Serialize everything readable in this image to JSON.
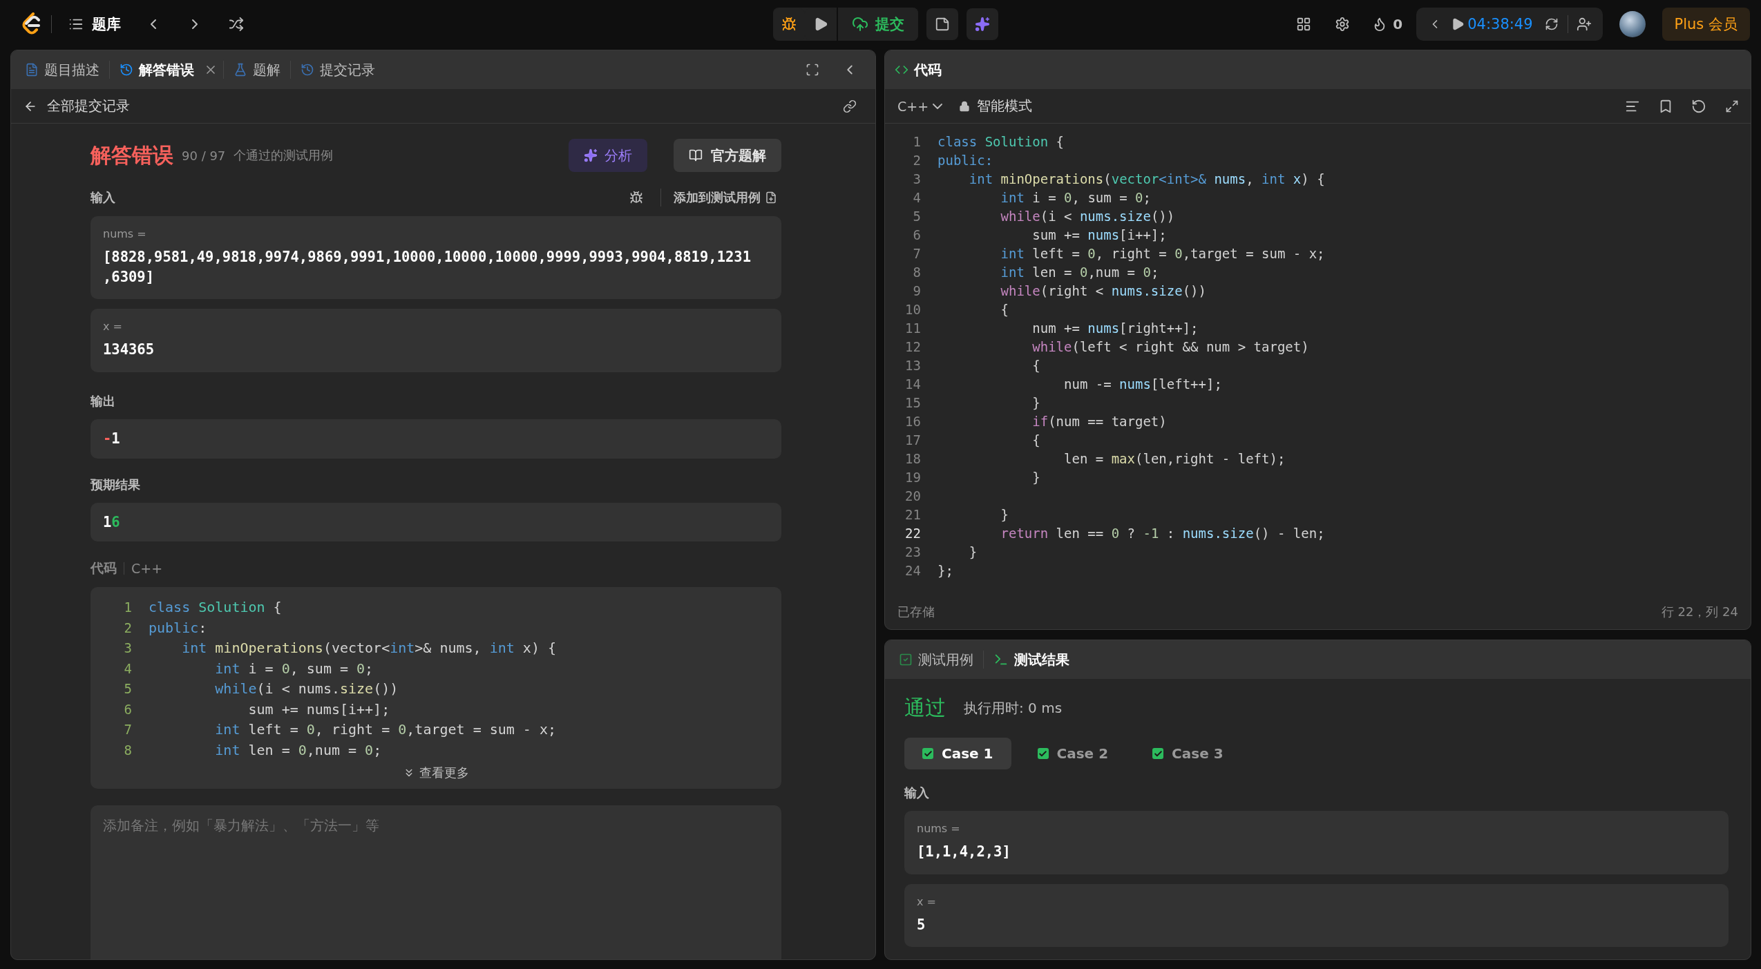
{
  "top_bar": {
    "nav_label": "题库",
    "submit_label": "提交",
    "streak": "0",
    "timer": "04:38:49",
    "plus_label": "Plus 会员"
  },
  "left_panel": {
    "tabs": [
      {
        "label": "题目描述",
        "selected": false,
        "closable": false
      },
      {
        "label": "解答错误",
        "selected": true,
        "closable": true
      },
      {
        "label": "题解",
        "selected": false,
        "closable": false
      },
      {
        "label": "提交记录",
        "selected": false,
        "closable": false
      }
    ],
    "back_link": "全部提交记录",
    "status": "解答错误",
    "passed_count": "90 / 97",
    "passed_label": "个通过的测试用例",
    "analyze_button": "分析",
    "official_button": "官方题解",
    "input_label": "输入",
    "add_testcase": "添加到测试用例",
    "inputs": [
      {
        "name": "nums =",
        "value": "[8828,9581,49,9818,9974,9869,9991,10000,10000,10000,9999,9993,9904,8819,1231,6309]"
      },
      {
        "name": "x =",
        "value": "134365"
      }
    ],
    "output_label": "输出",
    "output": [
      {
        "kind": "removed",
        "text": "-"
      },
      {
        "kind": "same",
        "text": "1"
      }
    ],
    "expected_label": "预期结果",
    "expected": [
      {
        "kind": "same",
        "text": "1"
      },
      {
        "kind": "added",
        "text": "6"
      }
    ],
    "code_label": "代码",
    "code_language": "C++",
    "code_lines": [
      {
        "number": "1",
        "tokens": [
          {
            "kind": "kw",
            "text": "class "
          },
          {
            "kind": "cls",
            "text": "Solution"
          },
          {
            "kind": "plain",
            "text": " {"
          }
        ]
      },
      {
        "number": "2",
        "tokens": [
          {
            "kind": "kw",
            "text": "public"
          },
          {
            "kind": "plain",
            "text": ":"
          }
        ]
      },
      {
        "number": "3",
        "tokens": [
          {
            "kind": "kw",
            "text": "    int "
          },
          {
            "kind": "fn",
            "text": "minOperations"
          },
          {
            "kind": "plain",
            "text": "(vector<"
          },
          {
            "kind": "kw",
            "text": "int"
          },
          {
            "kind": "plain",
            "text": ">& nums, "
          },
          {
            "kind": "kw",
            "text": "int"
          },
          {
            "kind": "plain",
            "text": " x) {"
          }
        ]
      },
      {
        "number": "4",
        "tokens": [
          {
            "kind": "kw",
            "text": "        int"
          },
          {
            "kind": "plain",
            "text": " i = "
          },
          {
            "kind": "num",
            "text": "0"
          },
          {
            "kind": "plain",
            "text": ", sum = "
          },
          {
            "kind": "num",
            "text": "0"
          },
          {
            "kind": "plain",
            "text": ";"
          }
        ]
      },
      {
        "number": "5",
        "tokens": [
          {
            "kind": "kw",
            "text": "        while"
          },
          {
            "kind": "plain",
            "text": "(i < nums."
          },
          {
            "kind": "fn",
            "text": "size"
          },
          {
            "kind": "plain",
            "text": "())"
          }
        ]
      },
      {
        "number": "6",
        "tokens": [
          {
            "kind": "plain",
            "text": "            sum += nums[i++];"
          }
        ]
      },
      {
        "number": "7",
        "tokens": [
          {
            "kind": "kw",
            "text": "        int"
          },
          {
            "kind": "plain",
            "text": " left = "
          },
          {
            "kind": "num",
            "text": "0"
          },
          {
            "kind": "plain",
            "text": ", right = "
          },
          {
            "kind": "num",
            "text": "0"
          },
          {
            "kind": "plain",
            "text": ",target = sum - x;"
          }
        ]
      },
      {
        "number": "8",
        "tokens": [
          {
            "kind": "kw",
            "text": "        int"
          },
          {
            "kind": "plain",
            "text": " len = "
          },
          {
            "kind": "num",
            "text": "0"
          },
          {
            "kind": "plain",
            "text": ",num = "
          },
          {
            "kind": "num",
            "text": "0"
          },
          {
            "kind": "plain",
            "text": ";"
          }
        ]
      }
    ],
    "show_more": "查看更多",
    "note_placeholder": "添加备注，例如「暴力解法」、「方法一」等"
  },
  "editor": {
    "title": "代码",
    "language": "C++",
    "mode": "智能模式",
    "lines": [
      {
        "number": "1",
        "current": false,
        "tokens": [
          {
            "kind": "kw",
            "text": "class "
          },
          {
            "kind": "cls",
            "text": "Solution"
          },
          {
            "kind": "plain",
            "text": " {"
          }
        ]
      },
      {
        "number": "2",
        "current": false,
        "tokens": [
          {
            "kind": "kw",
            "text": "public:"
          }
        ]
      },
      {
        "number": "3",
        "current": false,
        "tokens": [
          {
            "kind": "kw",
            "text": "    int "
          },
          {
            "kind": "fn",
            "text": "minOperations"
          },
          {
            "kind": "plain",
            "text": "("
          },
          {
            "kind": "cls",
            "text": "vector"
          },
          {
            "kind": "kw",
            "text": "<int>& "
          },
          {
            "kind": "var",
            "text": "nums"
          },
          {
            "kind": "plain",
            "text": ", "
          },
          {
            "kind": "kw",
            "text": "int "
          },
          {
            "kind": "var",
            "text": "x"
          },
          {
            "kind": "plain",
            "text": ") {"
          }
        ]
      },
      {
        "number": "4",
        "current": false,
        "tokens": [
          {
            "kind": "kw",
            "text": "        int"
          },
          {
            "kind": "plain",
            "text": " i = "
          },
          {
            "kind": "num",
            "text": "0"
          },
          {
            "kind": "plain",
            "text": ", sum = "
          },
          {
            "kind": "num",
            "text": "0"
          },
          {
            "kind": "plain",
            "text": ";"
          }
        ]
      },
      {
        "number": "5",
        "current": false,
        "tokens": [
          {
            "kind": "ctrl",
            "text": "        while"
          },
          {
            "kind": "plain",
            "text": "(i < "
          },
          {
            "kind": "var",
            "text": "nums.size"
          },
          {
            "kind": "plain",
            "text": "())"
          }
        ]
      },
      {
        "number": "6",
        "current": false,
        "tokens": [
          {
            "kind": "plain",
            "text": "            sum += "
          },
          {
            "kind": "var",
            "text": "nums"
          },
          {
            "kind": "plain",
            "text": "[i++];"
          }
        ]
      },
      {
        "number": "7",
        "current": false,
        "tokens": [
          {
            "kind": "kw",
            "text": "        int"
          },
          {
            "kind": "plain",
            "text": " left = "
          },
          {
            "kind": "num",
            "text": "0"
          },
          {
            "kind": "plain",
            "text": ", right = "
          },
          {
            "kind": "num",
            "text": "0"
          },
          {
            "kind": "plain",
            "text": ",target = sum - x;"
          }
        ]
      },
      {
        "number": "8",
        "current": false,
        "tokens": [
          {
            "kind": "kw",
            "text": "        int"
          },
          {
            "kind": "plain",
            "text": " len = "
          },
          {
            "kind": "num",
            "text": "0"
          },
          {
            "kind": "plain",
            "text": ",num = "
          },
          {
            "kind": "num",
            "text": "0"
          },
          {
            "kind": "plain",
            "text": ";"
          }
        ]
      },
      {
        "number": "9",
        "current": false,
        "tokens": [
          {
            "kind": "ctrl",
            "text": "        while"
          },
          {
            "kind": "plain",
            "text": "(right < "
          },
          {
            "kind": "var",
            "text": "nums.size"
          },
          {
            "kind": "plain",
            "text": "())"
          }
        ]
      },
      {
        "number": "10",
        "current": false,
        "tokens": [
          {
            "kind": "plain",
            "text": "        {"
          }
        ]
      },
      {
        "number": "11",
        "current": false,
        "tokens": [
          {
            "kind": "plain",
            "text": "            num += "
          },
          {
            "kind": "var",
            "text": "nums"
          },
          {
            "kind": "plain",
            "text": "[right++];"
          }
        ]
      },
      {
        "number": "12",
        "current": false,
        "tokens": [
          {
            "kind": "ctrl",
            "text": "            while"
          },
          {
            "kind": "plain",
            "text": "(left < right && num > target)"
          }
        ]
      },
      {
        "number": "13",
        "current": false,
        "tokens": [
          {
            "kind": "plain",
            "text": "            {"
          }
        ]
      },
      {
        "number": "14",
        "current": false,
        "tokens": [
          {
            "kind": "plain",
            "text": "                num -= "
          },
          {
            "kind": "var",
            "text": "nums"
          },
          {
            "kind": "plain",
            "text": "[left++];"
          }
        ]
      },
      {
        "number": "15",
        "current": false,
        "tokens": [
          {
            "kind": "plain",
            "text": "            }"
          }
        ]
      },
      {
        "number": "16",
        "current": false,
        "tokens": [
          {
            "kind": "ctrl",
            "text": "            if"
          },
          {
            "kind": "plain",
            "text": "(num == target)"
          }
        ]
      },
      {
        "number": "17",
        "current": false,
        "tokens": [
          {
            "kind": "plain",
            "text": "            {"
          }
        ]
      },
      {
        "number": "18",
        "current": false,
        "tokens": [
          {
            "kind": "plain",
            "text": "                len = "
          },
          {
            "kind": "fn",
            "text": "max"
          },
          {
            "kind": "plain",
            "text": "(len,right - left);"
          }
        ]
      },
      {
        "number": "19",
        "current": false,
        "tokens": [
          {
            "kind": "plain",
            "text": "            }"
          }
        ]
      },
      {
        "number": "20",
        "current": false
      },
      {
        "number": "21",
        "current": false,
        "tokens": [
          {
            "kind": "plain",
            "text": "        }"
          }
        ]
      },
      {
        "number": "22",
        "current": true,
        "tokens": [
          {
            "kind": "ctrl",
            "text": "        return"
          },
          {
            "kind": "plain",
            "text": " len == "
          },
          {
            "kind": "num",
            "text": "0"
          },
          {
            "kind": "plain",
            "text": " ? "
          },
          {
            "kind": "num",
            "text": "-1"
          },
          {
            "kind": "plain",
            "text": " : "
          },
          {
            "kind": "var",
            "text": "nums.size"
          },
          {
            "kind": "plain",
            "text": "() - len;"
          }
        ]
      },
      {
        "number": "23",
        "current": false,
        "tokens": [
          {
            "kind": "plain",
            "text": "    }"
          }
        ]
      },
      {
        "number": "24",
        "current": false,
        "tokens": [
          {
            "kind": "plain",
            "text": "};"
          }
        ]
      }
    ],
    "saved": "已存储",
    "cursor": "行 22，列 24"
  },
  "test_panel": {
    "tabs": [
      {
        "label": "测试用例",
        "selected": false
      },
      {
        "label": "测试结果",
        "selected": true
      }
    ],
    "result": "通过",
    "runtime": "执行用时: 0 ms",
    "cases": [
      {
        "label": "Case 1",
        "selected": true,
        "passed": true
      },
      {
        "label": "Case 2",
        "selected": false,
        "passed": true
      },
      {
        "label": "Case 3",
        "selected": false,
        "passed": true
      }
    ],
    "input_label": "输入",
    "inputs": [
      {
        "name": "nums =",
        "value": "[1,1,4,2,3]"
      },
      {
        "name": "x =",
        "value": "5"
      }
    ]
  }
}
